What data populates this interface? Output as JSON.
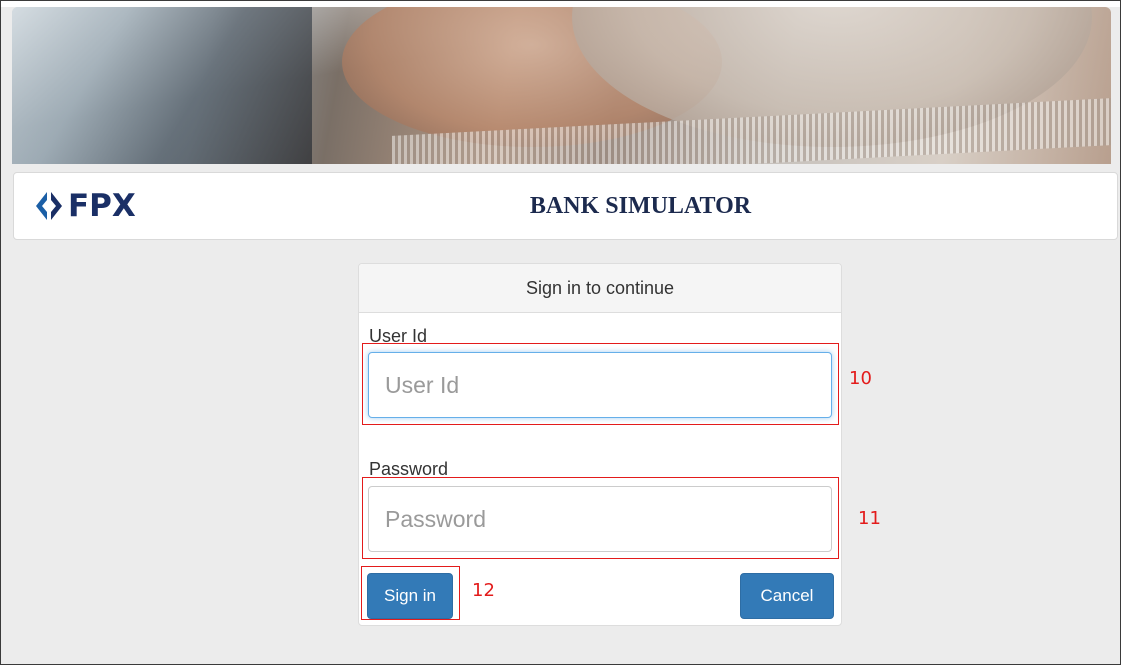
{
  "header": {
    "logo_text": "FPX",
    "title": "BANK SIMULATOR"
  },
  "login": {
    "heading": "Sign in to continue",
    "user_id_label": "User Id",
    "user_id_placeholder": "User Id",
    "user_id_value": "",
    "password_label": "Password",
    "password_placeholder": "Password",
    "password_value": "",
    "sign_in_label": "Sign in",
    "cancel_label": "Cancel"
  },
  "annotations": {
    "user_id_marker": "10",
    "password_marker": "11",
    "sign_in_marker": "12"
  },
  "colors": {
    "primary_button": "#337ab7",
    "annotation": "#e31b1b",
    "brand": "#1a2f66"
  }
}
